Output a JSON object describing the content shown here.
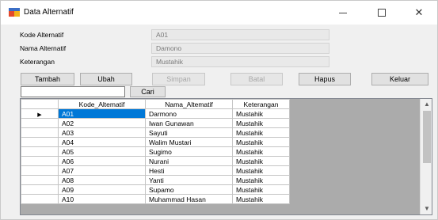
{
  "window": {
    "title": "Data Alternatif",
    "minimize": "—",
    "maximize": "☐",
    "close": "✕"
  },
  "form": {
    "kode_label": "Kode Alternatif",
    "kode_value": "A01",
    "nama_label": "Nama Alternatif",
    "nama_value": "Damono",
    "ket_label": "Keterangan",
    "ket_value": "Mustahik"
  },
  "toolbar": {
    "tambah": "Tambah",
    "ubah": "Ubah",
    "simpan": "Simpan",
    "batal": "Batal",
    "hapus": "Hapus",
    "keluar": "Keluar",
    "cari": "Cari",
    "search_value": ""
  },
  "grid": {
    "columns": [
      "Kode_Altematif",
      "Nama_Altematif",
      "Keterangan"
    ],
    "current_row_marker": "▶",
    "rows": [
      [
        "A01",
        "Darmono",
        "Mustahik"
      ],
      [
        "A02",
        "Iwan Gunawan",
        "Mustahik"
      ],
      [
        "A03",
        "Sayuti",
        "Mustahik"
      ],
      [
        "A04",
        "Walim Mustari",
        "Mustahik"
      ],
      [
        "A05",
        "Sugimo",
        "Mustahik"
      ],
      [
        "A06",
        "Nurani",
        "Mustahik"
      ],
      [
        "A07",
        "Hesti",
        "Mustahik"
      ],
      [
        "A08",
        "Yanti",
        "Mustahik"
      ],
      [
        "A09",
        "Supamo",
        "Mustahik"
      ],
      [
        "A10",
        "Muhammad Hasan",
        "Mustahik"
      ]
    ],
    "selected_color": "#0078d7",
    "scroll_up": "▲",
    "scroll_down": "▼"
  }
}
